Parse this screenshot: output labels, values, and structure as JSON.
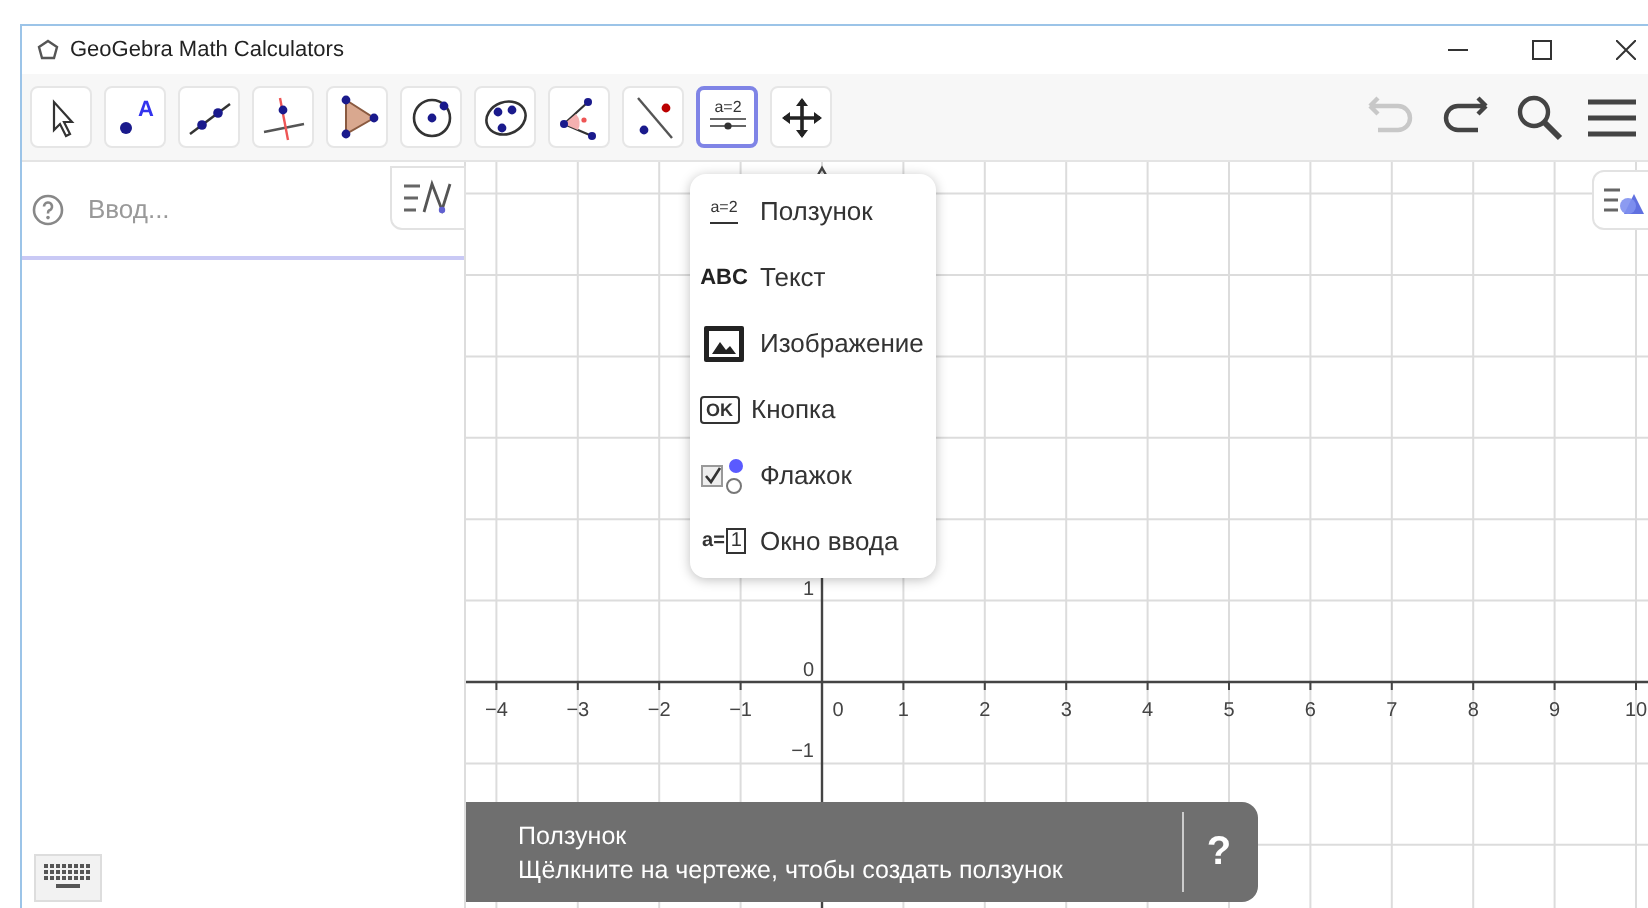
{
  "window": {
    "title": "GeoGebra Math Calculators"
  },
  "toolbar": {
    "tools": [
      {
        "kind": "move",
        "selected": false
      },
      {
        "kind": "point",
        "selected": false,
        "icon_text": "A"
      },
      {
        "kind": "line",
        "selected": false
      },
      {
        "kind": "perpendicular",
        "selected": false
      },
      {
        "kind": "polygon",
        "selected": false
      },
      {
        "kind": "circle",
        "selected": false
      },
      {
        "kind": "ellipse",
        "selected": false
      },
      {
        "kind": "angle",
        "selected": false
      },
      {
        "kind": "reflect",
        "selected": false
      },
      {
        "kind": "slider",
        "selected": true,
        "icon_text": "a=2"
      },
      {
        "kind": "pan",
        "selected": false
      }
    ],
    "undo_disabled": true,
    "redo_disabled": false
  },
  "algebra": {
    "input": {
      "placeholder": "Ввод..."
    }
  },
  "menu": {
    "items": [
      {
        "kind": "slider",
        "icon_text": "a=2",
        "label": "Ползунок"
      },
      {
        "kind": "text",
        "icon_text": "ABC",
        "label": "Текст"
      },
      {
        "kind": "image",
        "label": "Изображение"
      },
      {
        "kind": "button",
        "icon_text": "OK",
        "label": "Кнопка"
      },
      {
        "kind": "checkbox",
        "label": "Флажок"
      },
      {
        "kind": "inputbox",
        "icon_text": "a=",
        "icon_value": "1",
        "label": "Окно ввода"
      }
    ]
  },
  "graphics": {
    "x_labels": [
      "−4",
      "−3",
      "−2",
      "−1",
      "0",
      "1",
      "2",
      "3",
      "4",
      "5",
      "6",
      "7",
      "8",
      "9",
      "10"
    ],
    "y_labels": [
      "1",
      "0",
      "−1"
    ]
  },
  "toast": {
    "title": "Ползунок",
    "message": "Щёлкните на чертеже, чтобы создать ползунок",
    "help": "?"
  }
}
